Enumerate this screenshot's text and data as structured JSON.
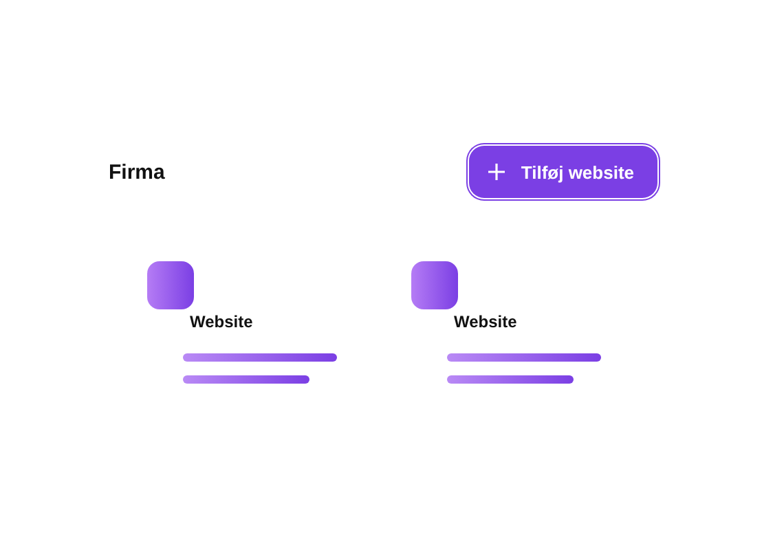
{
  "header": {
    "title": "Firma",
    "add_button": {
      "label": "Tilføj website"
    }
  },
  "websites": [
    {
      "label": "Website"
    },
    {
      "label": "Website"
    }
  ]
}
